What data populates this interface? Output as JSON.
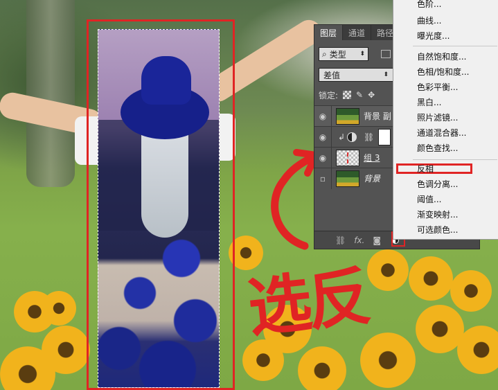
{
  "layers_panel": {
    "tabs": [
      "图层",
      "通道",
      "路径"
    ],
    "active_tab": 0,
    "filter_kind": "类型",
    "blend_mode": "差值",
    "lock_label": "锁定:",
    "layers": [
      {
        "name": "背景 副",
        "type": "photo",
        "visible": true
      },
      {
        "name": "",
        "type": "adjustment",
        "visible": true
      },
      {
        "name": "组 3",
        "type": "group",
        "visible": true
      },
      {
        "name": "背景",
        "type": "photo",
        "visible": false
      }
    ],
    "footer": {
      "fx_label": "fx."
    }
  },
  "adjustments_menu": {
    "items": [
      {
        "label": "色阶..."
      },
      {
        "label": "曲线..."
      },
      {
        "label": "曝光度..."
      },
      {
        "label": "自然饱和度..."
      },
      {
        "label": "色相/饱和度..."
      },
      {
        "label": "色彩平衡..."
      },
      {
        "label": "黑白..."
      },
      {
        "label": "照片滤镜..."
      },
      {
        "label": "通道混合器..."
      },
      {
        "label": "颜色查找..."
      },
      {
        "label": "反相"
      },
      {
        "label": "色调分离..."
      },
      {
        "label": "阈值..."
      },
      {
        "label": "渐变映射..."
      },
      {
        "label": "可选颜色..."
      }
    ],
    "highlighted_item": "反相"
  },
  "annotation": {
    "handwritten_text": "选反",
    "color": "#e02424"
  },
  "colors": {
    "panel_bg": "#535353",
    "menu_bg": "#f0f0f0",
    "annotation_red": "#e02424"
  }
}
